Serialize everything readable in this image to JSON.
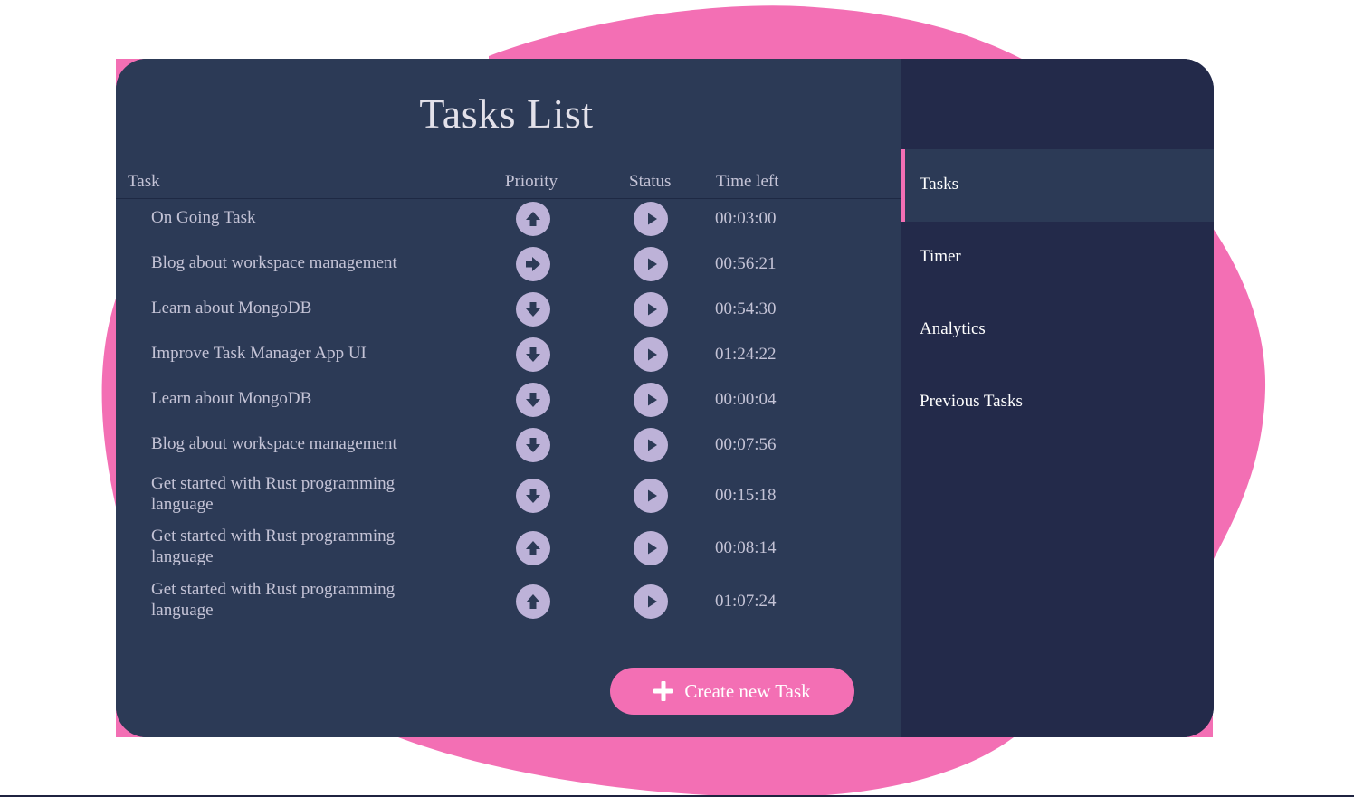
{
  "app": {
    "title": "Tasks List"
  },
  "colors": {
    "accent": "#f36fb4",
    "panel": "#2c3a56",
    "sidebar": "#232a4a",
    "icon_fill": "#bdb2d8",
    "text": "#c4c3d6"
  },
  "table": {
    "headers": {
      "task": "Task",
      "priority": "Priority",
      "status": "Status",
      "time_left": "Time left"
    },
    "rows": [
      {
        "task": "On Going Task",
        "priority_icon": "arrow-up-icon",
        "status_icon": "play-icon",
        "time_left": "00:03:00"
      },
      {
        "task": "Blog about workspace management",
        "priority_icon": "arrow-right-icon",
        "status_icon": "play-icon",
        "time_left": "00:56:21"
      },
      {
        "task": "Learn about MongoDB",
        "priority_icon": "arrow-down-icon",
        "status_icon": "play-icon",
        "time_left": "00:54:30"
      },
      {
        "task": "Improve Task Manager App UI",
        "priority_icon": "arrow-down-icon",
        "status_icon": "play-icon",
        "time_left": "01:24:22"
      },
      {
        "task": "Learn about MongoDB",
        "priority_icon": "arrow-down-icon",
        "status_icon": "play-icon",
        "time_left": "00:00:04"
      },
      {
        "task": "Blog about workspace management",
        "priority_icon": "arrow-down-icon",
        "status_icon": "play-icon",
        "time_left": "00:07:56"
      },
      {
        "task": "Get started with Rust programming language",
        "priority_icon": "arrow-down-icon",
        "status_icon": "play-icon",
        "time_left": "00:15:18"
      },
      {
        "task": "Get started with Rust programming language",
        "priority_icon": "arrow-up-icon",
        "status_icon": "play-icon",
        "time_left": "00:08:14"
      },
      {
        "task": "Get started with Rust programming language",
        "priority_icon": "arrow-up-icon",
        "status_icon": "play-icon",
        "time_left": "01:07:24"
      }
    ]
  },
  "actions": {
    "create_label": "Create new Task",
    "create_icon": "plus-icon"
  },
  "sidebar": {
    "items": [
      {
        "label": "Tasks",
        "active": true
      },
      {
        "label": "Timer",
        "active": false
      },
      {
        "label": "Analytics",
        "active": false
      },
      {
        "label": "Previous Tasks",
        "active": false
      }
    ]
  }
}
